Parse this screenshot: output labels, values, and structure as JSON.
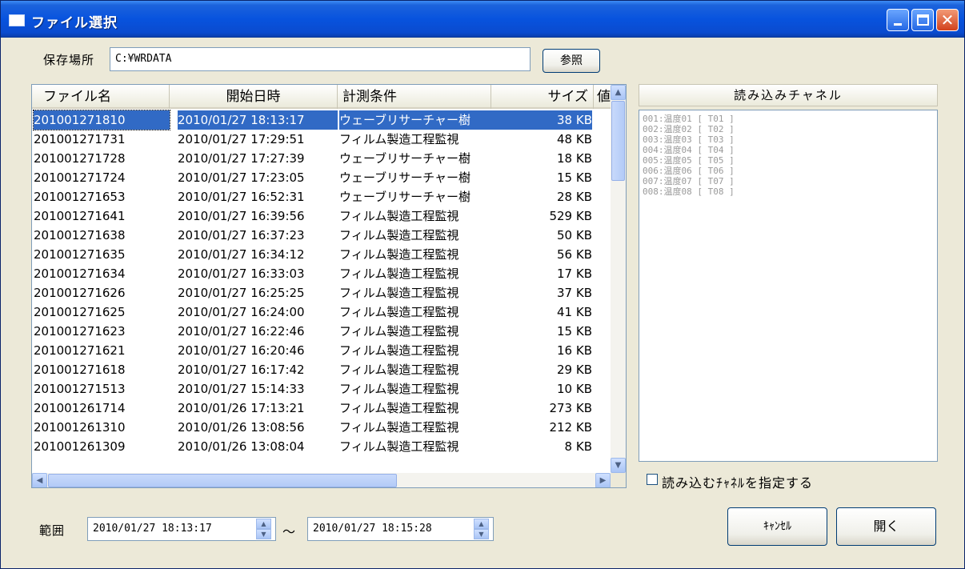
{
  "window": {
    "title": "ファイル選択"
  },
  "location": {
    "label": "保存場所",
    "value": "C:¥WRDATA",
    "browse_label": "参照"
  },
  "file_list": {
    "columns": [
      "ファイル名",
      "開始日時",
      "計測条件",
      "サイズ",
      "値"
    ],
    "rows": [
      {
        "name": "201001271810",
        "start": "2010/01/27 18:13:17",
        "condition": "ウェーブリサーチャー樹",
        "size": "38 KB",
        "selected": true
      },
      {
        "name": "201001271731",
        "start": "2010/01/27 17:29:51",
        "condition": "フィルム製造工程監視",
        "size": "48 KB"
      },
      {
        "name": "201001271728",
        "start": "2010/01/27 17:27:39",
        "condition": "ウェーブリサーチャー樹",
        "size": "18 KB"
      },
      {
        "name": "201001271724",
        "start": "2010/01/27 17:23:05",
        "condition": "ウェーブリサーチャー樹",
        "size": "15 KB"
      },
      {
        "name": "201001271653",
        "start": "2010/01/27 16:52:31",
        "condition": "ウェーブリサーチャー樹",
        "size": "28 KB"
      },
      {
        "name": "201001271641",
        "start": "2010/01/27 16:39:56",
        "condition": "フィルム製造工程監視",
        "size": "529 KB"
      },
      {
        "name": "201001271638",
        "start": "2010/01/27 16:37:23",
        "condition": "フィルム製造工程監視",
        "size": "50 KB"
      },
      {
        "name": "201001271635",
        "start": "2010/01/27 16:34:12",
        "condition": "フィルム製造工程監視",
        "size": "56 KB"
      },
      {
        "name": "201001271634",
        "start": "2010/01/27 16:33:03",
        "condition": "フィルム製造工程監視",
        "size": "17 KB"
      },
      {
        "name": "201001271626",
        "start": "2010/01/27 16:25:25",
        "condition": "フィルム製造工程監視",
        "size": "37 KB"
      },
      {
        "name": "201001271625",
        "start": "2010/01/27 16:24:00",
        "condition": "フィルム製造工程監視",
        "size": "41 KB"
      },
      {
        "name": "201001271623",
        "start": "2010/01/27 16:22:46",
        "condition": "フィルム製造工程監視",
        "size": "15 KB"
      },
      {
        "name": "201001271621",
        "start": "2010/01/27 16:20:46",
        "condition": "フィルム製造工程監視",
        "size": "16 KB"
      },
      {
        "name": "201001271618",
        "start": "2010/01/27 16:17:42",
        "condition": "フィルム製造工程監視",
        "size": "29 KB"
      },
      {
        "name": "201001271513",
        "start": "2010/01/27 15:14:33",
        "condition": "フィルム製造工程監視",
        "size": "10 KB"
      },
      {
        "name": "201001261714",
        "start": "2010/01/26 17:13:21",
        "condition": "フィルム製造工程監視",
        "size": "273 KB"
      },
      {
        "name": "201001261310",
        "start": "2010/01/26 13:08:56",
        "condition": "フィルム製造工程監視",
        "size": "212 KB"
      },
      {
        "name": "201001261309",
        "start": "2010/01/26 13:08:04",
        "condition": "フィルム製造工程監視",
        "size": "8 KB"
      }
    ]
  },
  "channels": {
    "header": "読み込みチャネル",
    "items": [
      "001:温度01 [ T01 ]",
      "002:温度02 [ T02 ]",
      "003:温度03 [ T03 ]",
      "004:温度04 [ T04 ]",
      "005:温度05 [ T05 ]",
      "006:温度06 [ T06 ]",
      "007:温度07 [ T07 ]",
      "008:温度08 [ T08 ]"
    ],
    "specify_label": "読み込むﾁｬﾈﾙを指定する"
  },
  "range": {
    "label": "範囲",
    "from": "2010/01/27 18:13:17",
    "separator": "～",
    "to": "2010/01/27 18:15:28"
  },
  "buttons": {
    "cancel": "ｷｬﾝｾﾙ",
    "open": "開く"
  },
  "colors": {
    "selection": "#316ac5",
    "titlebar": "#0853de",
    "window_bg": "#ece9d8"
  }
}
